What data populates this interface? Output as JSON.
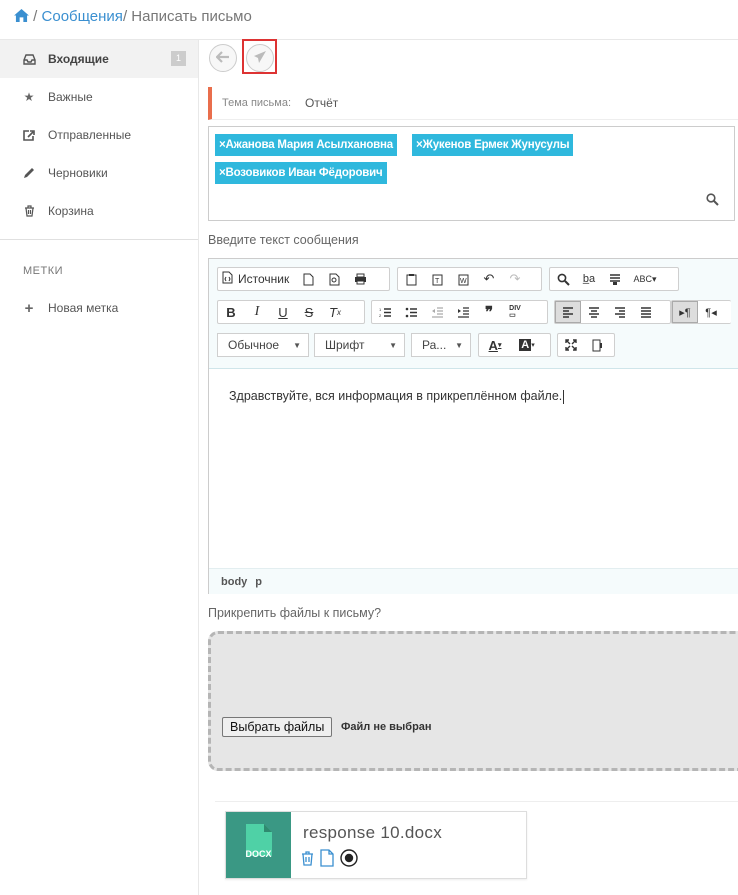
{
  "breadcrumb": {
    "home_icon": "home-icon",
    "messages": "Сообщения",
    "current": "Написать письмо"
  },
  "sidebar": {
    "items": [
      {
        "label": "Входящие",
        "icon": "inbox-icon",
        "badge": "1"
      },
      {
        "label": "Важные",
        "icon": "star-icon"
      },
      {
        "label": "Отправленные",
        "icon": "share-icon"
      },
      {
        "label": "Черновики",
        "icon": "pencil-icon"
      },
      {
        "label": "Корзина",
        "icon": "trash-icon"
      }
    ],
    "labels_heading": "МЕТКИ",
    "new_label": "Новая метка"
  },
  "toolbar": {
    "back_icon": "arrow-left-icon",
    "send_icon": "send-icon"
  },
  "subject": {
    "label": "Тема письма:",
    "value": "Отчёт"
  },
  "recipients": {
    "items": [
      "Ажанова Мария Асылхановна",
      "Жукенов Ермек Жунусулы",
      "Возовиков Иван Фёдорович"
    ],
    "remove_glyph": "×"
  },
  "editor": {
    "label": "Введите текст сообщения",
    "source_label": "Источник",
    "format_combo": "Обычное",
    "font_combo": "Шрифт",
    "size_combo": "Ра...",
    "content": "Здравствуйте, вся информация в прикреплённом файле.",
    "path": [
      "body",
      "p"
    ]
  },
  "attachments": {
    "label": "Прикрепить файлы к письму?",
    "choose_button": "Выбрать файлы",
    "no_file": "Файл не выбран",
    "file": {
      "name": "response 10.docx",
      "type": "DOCX"
    }
  },
  "colors": {
    "accent": "#3a8fd0",
    "tag": "#2fb8dd",
    "subject_border": "#e96e4c",
    "docx": "#3a9884",
    "highlight": "#dd3333"
  }
}
